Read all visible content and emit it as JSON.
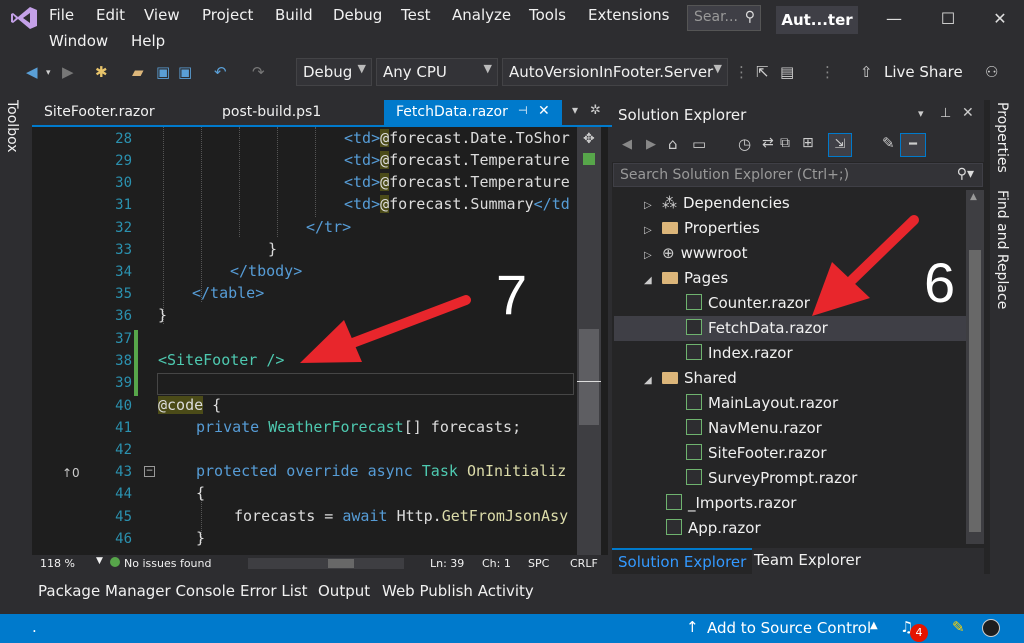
{
  "menu": {
    "items": [
      "File",
      "Edit",
      "View",
      "Project",
      "Build",
      "Debug",
      "Test",
      "Analyze",
      "Tools",
      "Extensions"
    ],
    "row2": [
      "Window",
      "Help"
    ],
    "search_placeholder": "Sear...",
    "solution_title": "Aut...ter"
  },
  "toolbar": {
    "config": "Debug",
    "platform": "Any CPU",
    "startup_project": "AutoVersionInFooter.Server",
    "live_share": "Live Share"
  },
  "left_strip": {
    "toolbox": "Toolbox"
  },
  "editor": {
    "tabs": [
      {
        "label": "SiteFooter.razor",
        "active": false
      },
      {
        "label": "post-build.ps1",
        "active": false
      },
      {
        "label": "FetchData.razor",
        "active": true
      }
    ],
    "lines": [
      {
        "n": "28"
      },
      {
        "n": "29"
      },
      {
        "n": "30"
      },
      {
        "n": "31"
      },
      {
        "n": "32"
      },
      {
        "n": "33"
      },
      {
        "n": "34"
      },
      {
        "n": "35"
      },
      {
        "n": "36"
      },
      {
        "n": "37"
      },
      {
        "n": "38"
      },
      {
        "n": "39"
      },
      {
        "n": "40"
      },
      {
        "n": "41"
      },
      {
        "n": "42"
      },
      {
        "n": "43"
      },
      {
        "n": "44"
      },
      {
        "n": "45"
      },
      {
        "n": "46"
      }
    ],
    "code": {
      "l28_tag": "<td>",
      "l28_razor": "@",
      "l28_expr": "forecast.Date.ToShor",
      "l29_tag": "<td>",
      "l29_razor": "@",
      "l29_expr": "forecast.Temperature",
      "l30_tag": "<td>",
      "l30_razor": "@",
      "l30_expr": "forecast.Temperature",
      "l31_tag": "<td>",
      "l31_razor": "@",
      "l31_expr": "forecast.Summary",
      "l31_close": "</td",
      "l32": "</tr>",
      "l33": "}",
      "l34": "</tbody>",
      "l35": "</table>",
      "l36": "}",
      "l38": "<SiteFooter />",
      "l40_code": "@code",
      "l40_brace": " {",
      "l41_kw": "private ",
      "l41_type": "WeatherForecast",
      "l41_rest": "[] forecasts;",
      "l43_kw": "protected override async ",
      "l43_type": "Task ",
      "l43_method": "OnInitializ",
      "l44": "{",
      "l45_plain": "forecasts = ",
      "l45_kw": "await ",
      "l45_call": "Http.",
      "l45_method": "GetFromJsonAsy",
      "l46": "}"
    },
    "ref_indicator": "↑0",
    "status": {
      "zoom": "118 %",
      "issues": "No issues found",
      "ln": "Ln: 39",
      "ch": "Ch: 1",
      "spc": "SPC",
      "crlf": "CRLF"
    }
  },
  "solution_explorer": {
    "title": "Solution Explorer",
    "search_placeholder": "Search Solution Explorer (Ctrl+;)",
    "items": [
      {
        "label": "Dependencies",
        "kind": "deps"
      },
      {
        "label": "Properties",
        "kind": "props"
      },
      {
        "label": "wwwroot",
        "kind": "globe"
      },
      {
        "label": "Pages",
        "kind": "folder"
      },
      {
        "label": "Counter.razor",
        "kind": "file"
      },
      {
        "label": "FetchData.razor",
        "kind": "file",
        "selected": true
      },
      {
        "label": "Index.razor",
        "kind": "file"
      },
      {
        "label": "Shared",
        "kind": "folder"
      },
      {
        "label": "MainLayout.razor",
        "kind": "file"
      },
      {
        "label": "NavMenu.razor",
        "kind": "file"
      },
      {
        "label": "SiteFooter.razor",
        "kind": "file"
      },
      {
        "label": "SurveyPrompt.razor",
        "kind": "file"
      },
      {
        "label": "_Imports.razor",
        "kind": "file"
      },
      {
        "label": "App.razor",
        "kind": "file"
      }
    ],
    "tabs": [
      "Solution Explorer",
      "Team Explorer"
    ]
  },
  "right_strip": {
    "properties": "Properties",
    "find_replace": "Find and Replace"
  },
  "bottom_tabs": [
    "Package Manager Console",
    "Error List",
    "Output",
    "Web Publish Activity"
  ],
  "statusbar": {
    "left": ".",
    "source_control": "Add to Source Control",
    "notifications": "4"
  },
  "annotations": {
    "arrow7": "7",
    "arrow6": "6"
  },
  "colors": {
    "accent": "#007acc",
    "annotation_arrow": "#e8262c",
    "code_keyword": "#569cd6",
    "code_type": "#4ec9b0",
    "code_method": "#dcdcaa"
  }
}
